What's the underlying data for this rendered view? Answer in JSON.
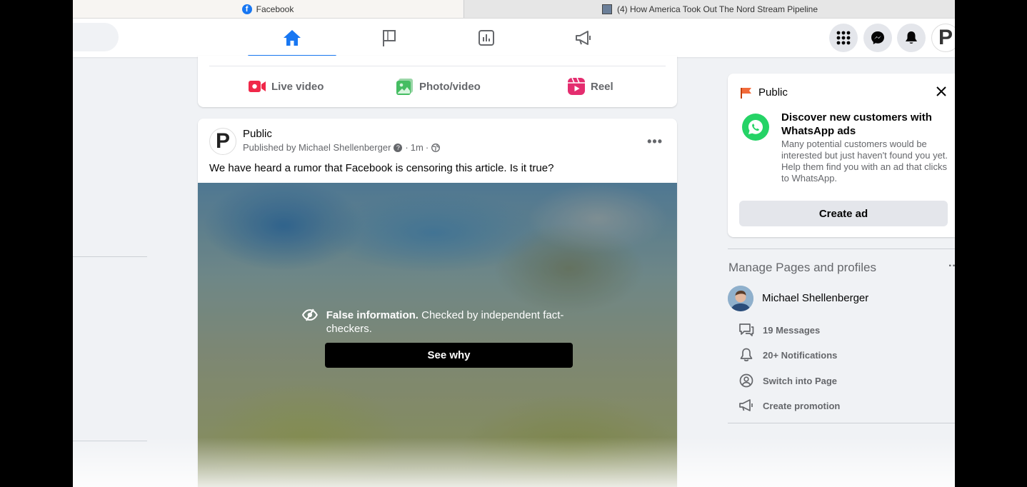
{
  "browser": {
    "tabs": [
      {
        "title": "Facebook",
        "favicon": "facebook-icon"
      },
      {
        "title": "(4) How America Took Out The Nord Stream Pipeline",
        "favicon": "video-thumbnail-icon"
      }
    ]
  },
  "topnav": {
    "tabs": [
      {
        "name": "home",
        "icon": "home-icon",
        "active": true
      },
      {
        "name": "pages",
        "icon": "flag-icon",
        "active": false
      },
      {
        "name": "insights",
        "icon": "chart-icon",
        "active": false
      },
      {
        "name": "ads",
        "icon": "megaphone-icon",
        "active": false
      }
    ],
    "buttons": [
      "menu-grid-icon",
      "messenger-icon",
      "bell-icon"
    ],
    "profile_initial": "P"
  },
  "composer": {
    "live_label": "Live video",
    "photo_label": "Photo/video",
    "reel_label": "Reel"
  },
  "post": {
    "avatar_initial": "P",
    "author": "Public",
    "published_by": "Published by Michael Shellenberger",
    "verified_glyph": "?",
    "time": "1m",
    "separator": "·",
    "audience_icon": "globe-icon",
    "more": "•••",
    "text": "We have heard a rumor that Facebook is censoring this article. Is it true?",
    "warning": {
      "icon": "eye-slash-icon",
      "title": "False information.",
      "body": "Checked by independent fact-checkers.",
      "button": "See why"
    }
  },
  "ad_card": {
    "page_name": "Public",
    "headline": "Discover new customers with WhatsApp ads",
    "body": "Many potential customers would be interested but just haven't found you yet. Help them find you with an ad that clicks to WhatsApp.",
    "button": "Create ad",
    "colors": {
      "whatsapp": "#25d366",
      "flag": "#f26b3a"
    }
  },
  "manage": {
    "title": "Manage Pages and profiles",
    "more": "···",
    "profile_name": "Michael Shellenberger",
    "items": [
      {
        "label": "19 Messages",
        "icon": "chat-bubble-icon"
      },
      {
        "label": "20+ Notifications",
        "icon": "bell-outline-icon"
      },
      {
        "label": "Switch into Page",
        "icon": "switch-profile-icon"
      },
      {
        "label": "Create promotion",
        "icon": "megaphone-outline-icon"
      }
    ]
  },
  "colors": {
    "accent": "#1877f2",
    "text_secondary": "#65676b",
    "background": "#f0f2f5"
  }
}
